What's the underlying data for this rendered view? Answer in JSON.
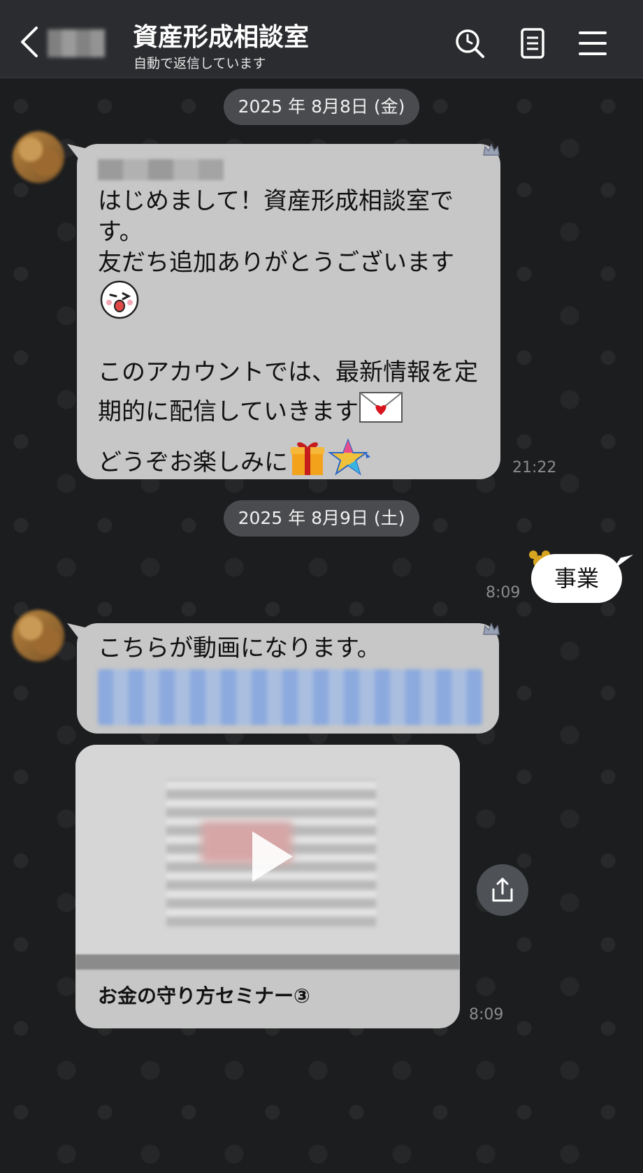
{
  "header": {
    "title": "資産形成相談室",
    "subtitle": "自動で返信しています"
  },
  "messages": {
    "date1": "2025 年 8月8日 (金)",
    "msg1": {
      "text": "はじめまして！資産形成相談室で\nす。\n友だち追加ありがとうございます",
      "text2": "このアカウントでは、最新情報を定\n期的に配信していきます",
      "text3": "どうぞお楽しみに",
      "time": "21:22"
    },
    "date2": "2025 年 8月9日 (土)",
    "outgoing": {
      "text": "事業",
      "time": "8:09"
    },
    "msg2": {
      "text": "こちらが動画になります。"
    },
    "video": {
      "caption": "お金の守り方セミナー③",
      "time": "8:09"
    }
  },
  "icons": {
    "back": "chevron-left-icon",
    "search": "search-history-icon",
    "notes": "notes-icon",
    "menu": "menu-icon",
    "share": "share-icon",
    "play": "play-icon"
  },
  "colors": {
    "background": "#1c1d1f",
    "header": "#2b2c2f",
    "bubble_in": "#c7c7c7",
    "bubble_out": "#ffffff",
    "date_pill": "#4a4b4e"
  }
}
